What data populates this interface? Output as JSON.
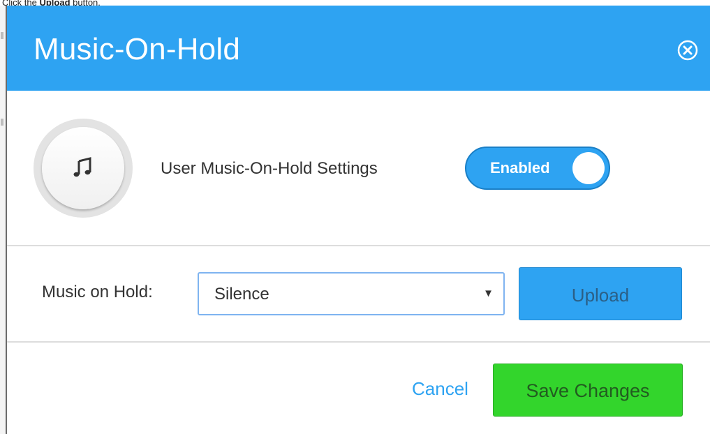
{
  "instruction": {
    "prefix": "Click the ",
    "emphasis": "Upload",
    "suffix": " button."
  },
  "modal": {
    "title": "Music-On-Hold",
    "close_icon": "close-circle-icon",
    "colors": {
      "header": "#2ea3f2",
      "primary_button": "#2ea3f2",
      "save_button": "#33d52c"
    }
  },
  "settings": {
    "avatar_icon": "music-note-icon",
    "label": "User Music-On-Hold Settings",
    "toggle": {
      "label": "Enabled",
      "state": "on"
    }
  },
  "music_on_hold": {
    "label": "Music on Hold:",
    "selected_value": "Silence",
    "upload_label": "Upload"
  },
  "footer": {
    "cancel_label": "Cancel",
    "save_label": "Save Changes"
  }
}
